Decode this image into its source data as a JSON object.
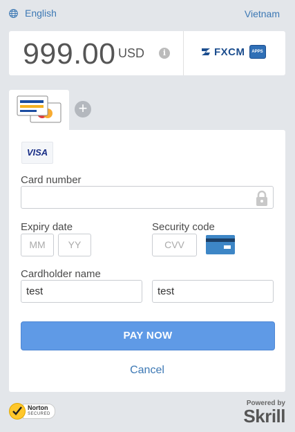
{
  "header": {
    "language": "English",
    "country": "Vietnam",
    "globe_icon": "globe-icon"
  },
  "payment": {
    "amount": "999.00",
    "currency": "USD",
    "info_icon": "i",
    "merchant_logo_text": "FXCM",
    "merchant_badge_text": "APPS"
  },
  "methods": {
    "active_tab_icon": "cards-icon",
    "add_icon": "+"
  },
  "form": {
    "card_brand": "VISA",
    "card_number_label": "Card number",
    "card_number_value": "",
    "expiry_label": "Expiry date",
    "expiry_month_placeholder": "MM",
    "expiry_year_placeholder": "YY",
    "security_label": "Security code",
    "cvv_placeholder": "CVV",
    "cardholder_label": "Cardholder name",
    "first_name_value": "test",
    "last_name_value": "test",
    "pay_button": "PAY NOW",
    "cancel_link": "Cancel"
  },
  "footer": {
    "norton_brand": "Norton",
    "norton_sub": "SECURED",
    "powered_by": "Powered by",
    "provider": "Skrill"
  },
  "colors": {
    "accent": "#5f9ae6",
    "link": "#3c78b4",
    "background": "#e3e6ea"
  }
}
